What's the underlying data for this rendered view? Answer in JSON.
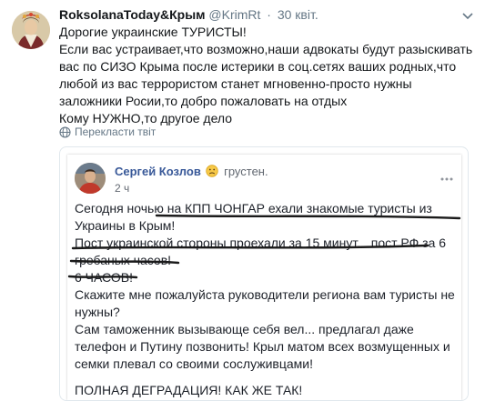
{
  "tweet": {
    "author_name": "RoksolanaToday&Крым",
    "author_handle": "@KrimRt",
    "separator": "·",
    "timestamp": "30 квіт.",
    "text_lines": [
      "Дорогие украинские ТУРИСТЫ!",
      "Если вас устраивает,что возможно,наши адвокаты будут разыскивать вас по СИЗО Крыма после истерики в соц.сетях ваших родных,что любой из вас террористом станет мгновенно-просто нужны заложники Росии,то добро пожаловать на отдых",
      "Кому НУЖНО,то другое дело"
    ],
    "translate_label": "Перекласти твіт"
  },
  "quoted_post": {
    "author_name": "Сергей Козлов",
    "feeling": "грустен.",
    "time": "2 ч",
    "paragraphs": [
      "Сегодня ночью на КПП ЧОНГАР ехали знакомые туристы из Украины в Крым!",
      "Пост украинской стороны проехали за 15 минут... пост РФ за 6 гребаных часов!",
      "6 ЧАСОВ!",
      "Скажите мне пожалуйста руководители региона вам туристы не нужны?",
      "Сам таможенник вызывающе себя вел... предлагал даже телефон и Путину позвонить! Крыл матом всех возмущенных и семки плевал со своими сослуживцами!",
      "ПОЛНАЯ ДЕГРАДАЦИЯ! КАК ЖЕ ТАК!"
    ]
  },
  "colors": {
    "link_name": "#385898",
    "muted": "#657786",
    "text": "#14171a",
    "border": "#e1e8ed"
  },
  "icons": {
    "caret": "chevron-down-icon",
    "translate": "globe-icon",
    "emoji": "sad-face-icon",
    "more": "more-dots-icon"
  }
}
